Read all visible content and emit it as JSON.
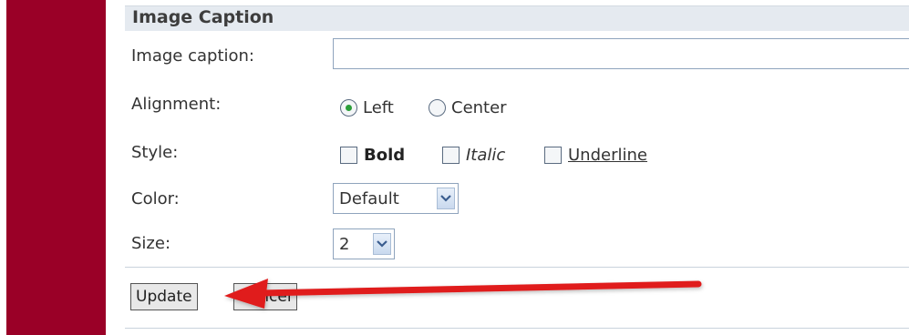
{
  "section": {
    "title": "Image Caption"
  },
  "caption": {
    "label": "Image caption:",
    "value": ""
  },
  "alignment": {
    "label": "Alignment:",
    "options": [
      {
        "label": "Left",
        "checked": true
      },
      {
        "label": "Center",
        "checked": false
      }
    ]
  },
  "style": {
    "label": "Style:",
    "options": [
      {
        "label": "Bold",
        "checked": false
      },
      {
        "label": "Italic",
        "checked": false
      },
      {
        "label": "Underline",
        "checked": false
      }
    ]
  },
  "color": {
    "label": "Color:",
    "selected": "Default"
  },
  "size": {
    "label": "Size:",
    "selected": "2"
  },
  "buttons": {
    "update": "Update",
    "cancel": "Cancel"
  },
  "theme": {
    "sidebar_color": "#9a0027",
    "header_color": "#e5eaf0",
    "arrow_color": "#e01b1b",
    "radio_dot_color": "#2c9e3a"
  }
}
